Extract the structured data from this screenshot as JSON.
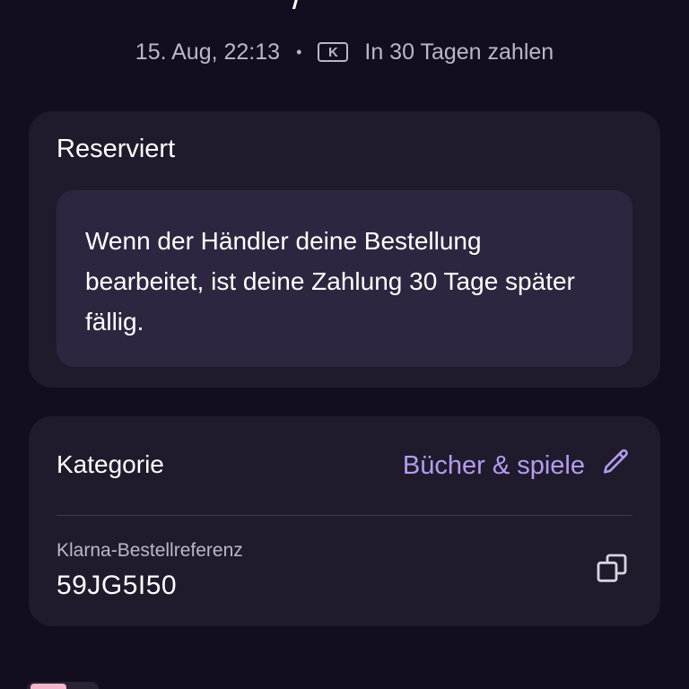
{
  "header": {
    "clipped_glyph": "/",
    "date_time": "15. Aug, 22:13",
    "separator": "•",
    "provider_badge": "K",
    "payment_plan": "In 30 Tagen zahlen"
  },
  "status_card": {
    "title": "Reserviert",
    "message": "Wenn der Händler deine Bestellung bearbeitet, ist deine Zahlung 30 Tage später fällig."
  },
  "details_card": {
    "category_label": "Kategorie",
    "category_value": "Bücher & spiele",
    "edit_icon": "pencil-icon",
    "reference_label": "Klarna-Bestellreferenz",
    "reference_value": "59JG5I50",
    "copy_icon": "copy-icon"
  },
  "colors": {
    "background": "#120d1f",
    "card": "#201b2c",
    "info_box": "#2e2640",
    "accent": "#b49cf0",
    "muted_text": "#bdb6c8"
  }
}
